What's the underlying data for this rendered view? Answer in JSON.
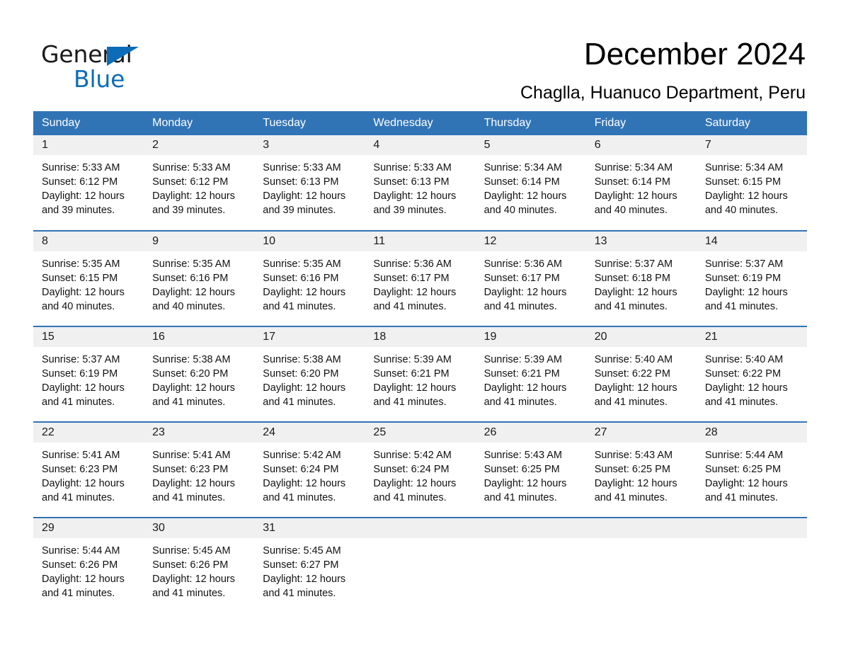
{
  "brand": {
    "name_part1": "General",
    "name_part2": "Blue"
  },
  "header": {
    "title": "December 2024",
    "subtitle": "Chaglla, Huanuco Department, Peru"
  },
  "calendar": {
    "weekday_headers": [
      "Sunday",
      "Monday",
      "Tuesday",
      "Wednesday",
      "Thursday",
      "Friday",
      "Saturday"
    ],
    "colors": {
      "header_blue": "#3174b6",
      "daynum_band": "#f0f0f0",
      "brand_blue": "#0d6cb8",
      "text": "#111111"
    },
    "weeks": [
      [
        {
          "day": "1",
          "sunrise": "Sunrise: 5:33 AM",
          "sunset": "Sunset: 6:12 PM",
          "daylight_line1": "Daylight: 12 hours",
          "daylight_line2": "and 39 minutes."
        },
        {
          "day": "2",
          "sunrise": "Sunrise: 5:33 AM",
          "sunset": "Sunset: 6:12 PM",
          "daylight_line1": "Daylight: 12 hours",
          "daylight_line2": "and 39 minutes."
        },
        {
          "day": "3",
          "sunrise": "Sunrise: 5:33 AM",
          "sunset": "Sunset: 6:13 PM",
          "daylight_line1": "Daylight: 12 hours",
          "daylight_line2": "and 39 minutes."
        },
        {
          "day": "4",
          "sunrise": "Sunrise: 5:33 AM",
          "sunset": "Sunset: 6:13 PM",
          "daylight_line1": "Daylight: 12 hours",
          "daylight_line2": "and 39 minutes."
        },
        {
          "day": "5",
          "sunrise": "Sunrise: 5:34 AM",
          "sunset": "Sunset: 6:14 PM",
          "daylight_line1": "Daylight: 12 hours",
          "daylight_line2": "and 40 minutes."
        },
        {
          "day": "6",
          "sunrise": "Sunrise: 5:34 AM",
          "sunset": "Sunset: 6:14 PM",
          "daylight_line1": "Daylight: 12 hours",
          "daylight_line2": "and 40 minutes."
        },
        {
          "day": "7",
          "sunrise": "Sunrise: 5:34 AM",
          "sunset": "Sunset: 6:15 PM",
          "daylight_line1": "Daylight: 12 hours",
          "daylight_line2": "and 40 minutes."
        }
      ],
      [
        {
          "day": "8",
          "sunrise": "Sunrise: 5:35 AM",
          "sunset": "Sunset: 6:15 PM",
          "daylight_line1": "Daylight: 12 hours",
          "daylight_line2": "and 40 minutes."
        },
        {
          "day": "9",
          "sunrise": "Sunrise: 5:35 AM",
          "sunset": "Sunset: 6:16 PM",
          "daylight_line1": "Daylight: 12 hours",
          "daylight_line2": "and 40 minutes."
        },
        {
          "day": "10",
          "sunrise": "Sunrise: 5:35 AM",
          "sunset": "Sunset: 6:16 PM",
          "daylight_line1": "Daylight: 12 hours",
          "daylight_line2": "and 41 minutes."
        },
        {
          "day": "11",
          "sunrise": "Sunrise: 5:36 AM",
          "sunset": "Sunset: 6:17 PM",
          "daylight_line1": "Daylight: 12 hours",
          "daylight_line2": "and 41 minutes."
        },
        {
          "day": "12",
          "sunrise": "Sunrise: 5:36 AM",
          "sunset": "Sunset: 6:17 PM",
          "daylight_line1": "Daylight: 12 hours",
          "daylight_line2": "and 41 minutes."
        },
        {
          "day": "13",
          "sunrise": "Sunrise: 5:37 AM",
          "sunset": "Sunset: 6:18 PM",
          "daylight_line1": "Daylight: 12 hours",
          "daylight_line2": "and 41 minutes."
        },
        {
          "day": "14",
          "sunrise": "Sunrise: 5:37 AM",
          "sunset": "Sunset: 6:19 PM",
          "daylight_line1": "Daylight: 12 hours",
          "daylight_line2": "and 41 minutes."
        }
      ],
      [
        {
          "day": "15",
          "sunrise": "Sunrise: 5:37 AM",
          "sunset": "Sunset: 6:19 PM",
          "daylight_line1": "Daylight: 12 hours",
          "daylight_line2": "and 41 minutes."
        },
        {
          "day": "16",
          "sunrise": "Sunrise: 5:38 AM",
          "sunset": "Sunset: 6:20 PM",
          "daylight_line1": "Daylight: 12 hours",
          "daylight_line2": "and 41 minutes."
        },
        {
          "day": "17",
          "sunrise": "Sunrise: 5:38 AM",
          "sunset": "Sunset: 6:20 PM",
          "daylight_line1": "Daylight: 12 hours",
          "daylight_line2": "and 41 minutes."
        },
        {
          "day": "18",
          "sunrise": "Sunrise: 5:39 AM",
          "sunset": "Sunset: 6:21 PM",
          "daylight_line1": "Daylight: 12 hours",
          "daylight_line2": "and 41 minutes."
        },
        {
          "day": "19",
          "sunrise": "Sunrise: 5:39 AM",
          "sunset": "Sunset: 6:21 PM",
          "daylight_line1": "Daylight: 12 hours",
          "daylight_line2": "and 41 minutes."
        },
        {
          "day": "20",
          "sunrise": "Sunrise: 5:40 AM",
          "sunset": "Sunset: 6:22 PM",
          "daylight_line1": "Daylight: 12 hours",
          "daylight_line2": "and 41 minutes."
        },
        {
          "day": "21",
          "sunrise": "Sunrise: 5:40 AM",
          "sunset": "Sunset: 6:22 PM",
          "daylight_line1": "Daylight: 12 hours",
          "daylight_line2": "and 41 minutes."
        }
      ],
      [
        {
          "day": "22",
          "sunrise": "Sunrise: 5:41 AM",
          "sunset": "Sunset: 6:23 PM",
          "daylight_line1": "Daylight: 12 hours",
          "daylight_line2": "and 41 minutes."
        },
        {
          "day": "23",
          "sunrise": "Sunrise: 5:41 AM",
          "sunset": "Sunset: 6:23 PM",
          "daylight_line1": "Daylight: 12 hours",
          "daylight_line2": "and 41 minutes."
        },
        {
          "day": "24",
          "sunrise": "Sunrise: 5:42 AM",
          "sunset": "Sunset: 6:24 PM",
          "daylight_line1": "Daylight: 12 hours",
          "daylight_line2": "and 41 minutes."
        },
        {
          "day": "25",
          "sunrise": "Sunrise: 5:42 AM",
          "sunset": "Sunset: 6:24 PM",
          "daylight_line1": "Daylight: 12 hours",
          "daylight_line2": "and 41 minutes."
        },
        {
          "day": "26",
          "sunrise": "Sunrise: 5:43 AM",
          "sunset": "Sunset: 6:25 PM",
          "daylight_line1": "Daylight: 12 hours",
          "daylight_line2": "and 41 minutes."
        },
        {
          "day": "27",
          "sunrise": "Sunrise: 5:43 AM",
          "sunset": "Sunset: 6:25 PM",
          "daylight_line1": "Daylight: 12 hours",
          "daylight_line2": "and 41 minutes."
        },
        {
          "day": "28",
          "sunrise": "Sunrise: 5:44 AM",
          "sunset": "Sunset: 6:25 PM",
          "daylight_line1": "Daylight: 12 hours",
          "daylight_line2": "and 41 minutes."
        }
      ],
      [
        {
          "day": "29",
          "sunrise": "Sunrise: 5:44 AM",
          "sunset": "Sunset: 6:26 PM",
          "daylight_line1": "Daylight: 12 hours",
          "daylight_line2": "and 41 minutes."
        },
        {
          "day": "30",
          "sunrise": "Sunrise: 5:45 AM",
          "sunset": "Sunset: 6:26 PM",
          "daylight_line1": "Daylight: 12 hours",
          "daylight_line2": "and 41 minutes."
        },
        {
          "day": "31",
          "sunrise": "Sunrise: 5:45 AM",
          "sunset": "Sunset: 6:27 PM",
          "daylight_line1": "Daylight: 12 hours",
          "daylight_line2": "and 41 minutes."
        },
        {
          "day": "",
          "sunrise": "",
          "sunset": "",
          "daylight_line1": "",
          "daylight_line2": ""
        },
        {
          "day": "",
          "sunrise": "",
          "sunset": "",
          "daylight_line1": "",
          "daylight_line2": ""
        },
        {
          "day": "",
          "sunrise": "",
          "sunset": "",
          "daylight_line1": "",
          "daylight_line2": ""
        },
        {
          "day": "",
          "sunrise": "",
          "sunset": "",
          "daylight_line1": "",
          "daylight_line2": ""
        }
      ]
    ]
  }
}
